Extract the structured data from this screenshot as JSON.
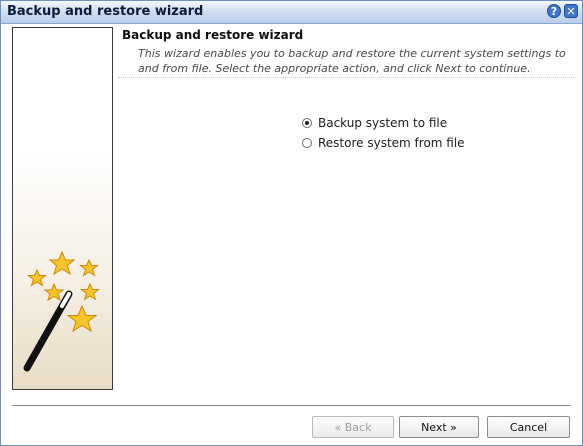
{
  "window": {
    "title": "Backup and restore wizard",
    "help_symbol": "?",
    "close_symbol": "✕"
  },
  "header": {
    "title": "Backup and restore wizard",
    "description": "This wizard enables you to backup and restore the current system settings to and from file. Select the appropriate action, and click Next to continue."
  },
  "options": [
    {
      "label": "Backup system to file",
      "selected": true
    },
    {
      "label": "Restore system from file",
      "selected": false
    }
  ],
  "buttons": {
    "back": "« Back",
    "next": "Next »",
    "cancel": "Cancel"
  },
  "icons": {
    "help": "help-icon",
    "close": "close-icon",
    "wizard": "magic-wand-icon"
  },
  "colors": {
    "titlebar": "#cbdaef",
    "star": "#f6c52b"
  }
}
